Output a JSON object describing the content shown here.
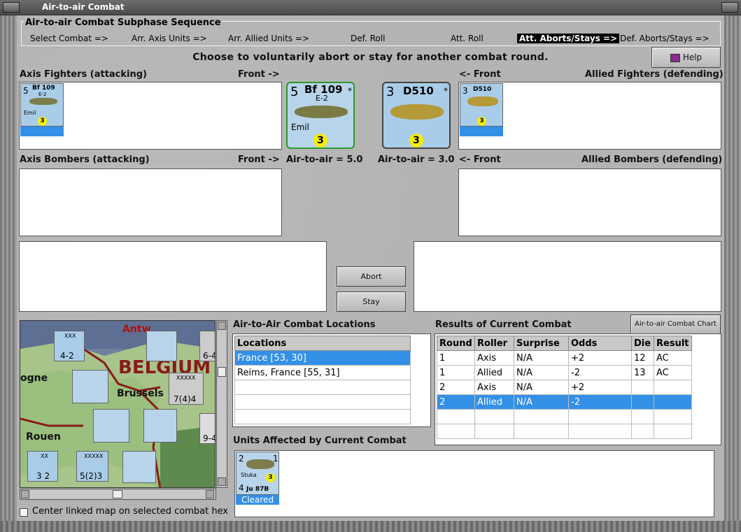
{
  "window": {
    "title": "Air-to-air Combat"
  },
  "sequence": {
    "title": "Air-to-air Combat Subphase Sequence",
    "steps": [
      "Select Combat =>",
      "Arr. Axis Units =>",
      "Arr. Allied Units =>",
      "Def. Roll",
      "Att. Roll",
      "Att. Aborts/Stays =>",
      "Def. Aborts/Stays =>"
    ]
  },
  "instruction": "Choose to voluntarily abort or stay for another combat round.",
  "help_label": "Help",
  "labels": {
    "axis_fighters": "Axis Fighters (attacking)",
    "front_right": "Front ->",
    "front_left": "<- Front",
    "allied_fighters": "Allied Fighters (defending)",
    "axis_bombers": "Axis Bombers (attacking)",
    "allied_bombers": "Allied Bombers (defending)",
    "axis_a2a": "Air-to-air = 5.0",
    "allied_a2a": "Air-to-air = 3.0"
  },
  "axis_unit": {
    "name": "Bf 109",
    "variant": "E-2",
    "nickname": "Emil",
    "left_value": "5",
    "dot": "3",
    "star": "*"
  },
  "allied_unit": {
    "name": "D510",
    "left_value": "3",
    "dot": "3",
    "star": "*"
  },
  "buttons": {
    "abort": "Abort",
    "stay": "Stay",
    "chart": "Air-to-air Combat Chart"
  },
  "locations": {
    "title": "Air-to-Air Combat Locations",
    "header": "Locations",
    "rows": [
      "France [53, 30]",
      "Reims, France [55, 31]"
    ]
  },
  "results": {
    "title": "Results of Current Combat",
    "headers": [
      "Round",
      "Roller",
      "Surprise",
      "Odds",
      "Die",
      "Result"
    ],
    "rows": [
      [
        "1",
        "Axis",
        "N/A",
        "+2",
        "12",
        "AC"
      ],
      [
        "1",
        "Allied",
        "N/A",
        "-2",
        "13",
        "AC"
      ],
      [
        "2",
        "Axis",
        "N/A",
        "+2",
        "",
        ""
      ],
      [
        "2",
        "Allied",
        "N/A",
        "-2",
        "",
        ""
      ]
    ]
  },
  "affected": {
    "title": "Units Affected by Current Combat",
    "unit": {
      "name": "Stuka",
      "type": "Ju 87B",
      "top_left": "2",
      "top_right": "1",
      "left": "4",
      "dot": "3",
      "status": "Cleared"
    }
  },
  "map": {
    "labels": [
      "Antw",
      "BELGIUM",
      "Brussels",
      "ogne",
      "Rouen"
    ],
    "counters": [
      {
        "top": "XXX",
        "bottom": "4-2"
      },
      {
        "top": "XXXXX",
        "bottom": "7(4)4"
      },
      {
        "top": "XX",
        "bottom": "3 2"
      },
      {
        "top": "XXXXX",
        "bottom": "5(2)3"
      },
      {
        "top": "",
        "bottom": "6-4"
      },
      {
        "top": "",
        "bottom": "9-4"
      }
    ]
  },
  "center_map_label": "Center linked map on selected combat hex"
}
